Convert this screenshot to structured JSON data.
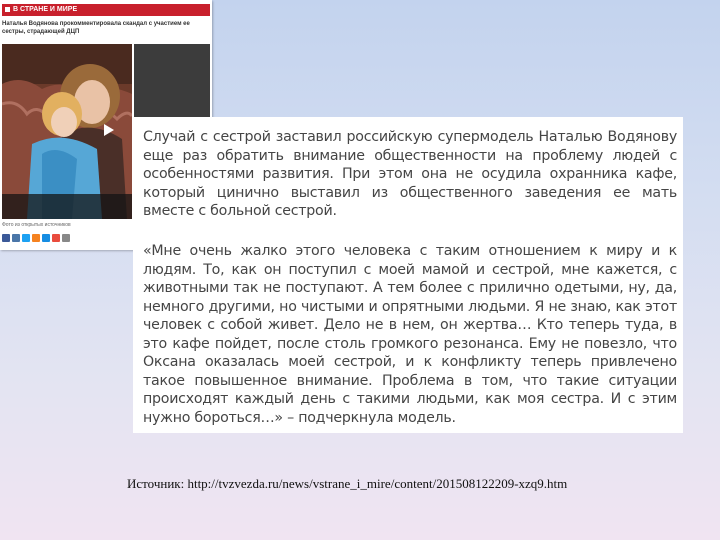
{
  "clip": {
    "section_label": "В СТРАНЕ И МИРЕ",
    "headline": "Наталья Водянова прокомментировала скандал с участием ее сестры, страдающей ДЦП",
    "caption": "Фото из открытых источников",
    "photo_desc": "two girls sitting together on a patterned sofa"
  },
  "quote": {
    "paragraph1": "Случай с сестрой заставил российскую супермодель Наталью Водянову еще раз обратить внимание общественности на проблему людей с особенностями развития. При этом она не осудила охранника кафе, который цинично выставил из общественного заведения ее мать вместе с больной сестрой.",
    "paragraph2": "«Мне очень жалко этого человека с таким отношением к миру и к людям. То, как он поступил с моей мамой и сестрой, мне кажется, с животными так не поступают. А тем более с прилично одетыми, ну, да, немного другими, но чистыми и опрятными людьми. Я не знаю, как этот человек с собой живет. Дело не в нем, он жертва… Кто теперь туда, в это кафе пойдет, после столь громкого резонанса. Ему не повезло, что Оксана оказалась  моей сестрой, и к конфликту теперь привлечено такое повышенное  внимание. Проблема в том, что такие ситуации  происходят каждый день с такими людьми, как моя сестра. И с этим нужно бороться…» – подчеркнула модель."
  },
  "source_line": "Источник: http://tvzvezda.ru/news/vstrane_i_mire/content/201508122209-xzq9.htm",
  "colors": {
    "header_red": "#c8202c",
    "text_gray": "#454545"
  }
}
